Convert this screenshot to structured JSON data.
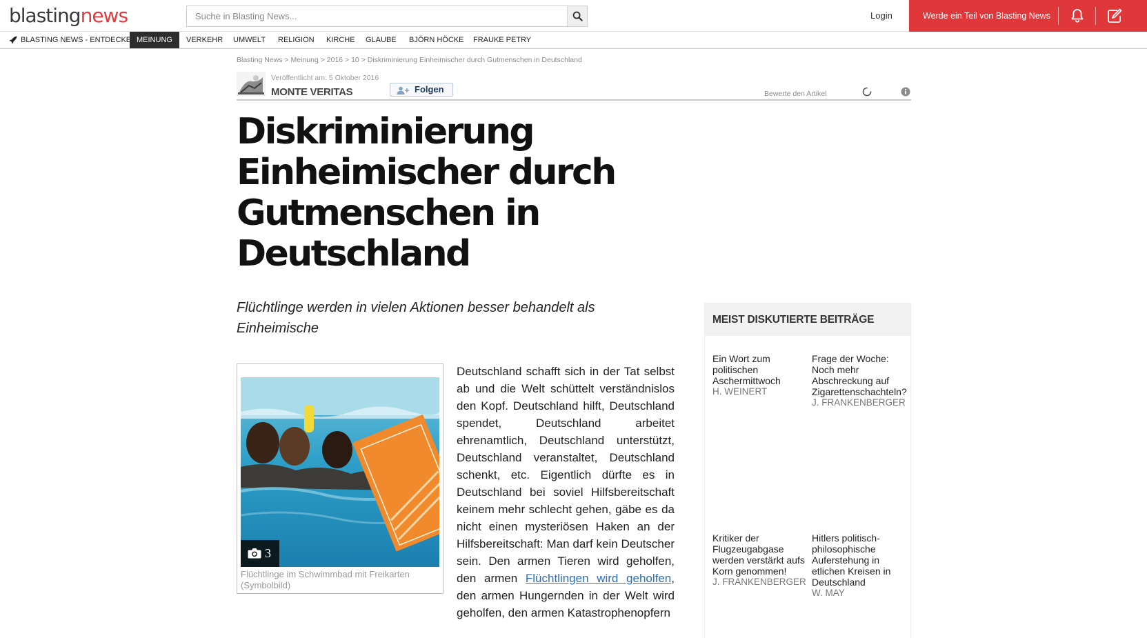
{
  "header": {
    "logo_part1": "blasting",
    "logo_part2": "news",
    "search_placeholder": "Suche in Blasting News...",
    "login_label": "Login",
    "cta_label": "Werde ein Teil von Blasting News",
    "colors": {
      "brand_red": "#e0373a",
      "nav_active": "#2d2d2d",
      "link_blue": "#2a6fb8"
    }
  },
  "nav": {
    "home_label": "BLASTING NEWS - ENTDECKE",
    "items": [
      "MEINUNG",
      "VERKEHR",
      "UMWELT",
      "RELIGION",
      "KIRCHE",
      "GLAUBE",
      "BJÖRN HÖCKE",
      "FRAUKE PETRY"
    ],
    "active": "MEINUNG"
  },
  "breadcrumb": [
    "Blasting News",
    "Meinung",
    "2016",
    "10",
    "Diskriminierung Einheimischer durch Gutmenschen in Deutschland"
  ],
  "article": {
    "published": "Veröffentlicht am: 5 Oktober 2016",
    "author": "MONTE VERITAS",
    "follow_label": "Folgen",
    "rate_label": "Bewerte den Artikel",
    "title": "Diskriminierung Einheimischer durch Gutmenschen in Deutschland",
    "subtitle": "Flüchtlinge werden in vielen Aktionen besser behandelt als Einheimische",
    "photo_count": "3",
    "photo_caption": "Flüchtlinge im Schwimmbad mit Freikarten (Symbolbild)",
    "body_before_link": "Deutschland schafft sich in der Tat selbst ab und die Welt schüttelt verständnislos den Kopf. Deutschland hilft, Deutschland spendet, Deutschland arbeitet ehrenamtlich, Deutschland unterstützt, Deutschland veranstaltet, Deutschland schenkt, etc. Eigentlich dürfte es in Deutschland bei soviel Hilfsbereitschaft keinem mehr schlecht gehen, gäbe es da nicht einen mysteriösen Haken an der Hilfsbereitschaft: Man darf kein Deutscher sein. Den armen Tieren wird geholfen, den armen ",
    "body_link": "Flüchtlingen wird geholfen",
    "body_after_link": ", den armen Hungernden in der Welt wird geholfen, den armen Katastrophenopfern"
  },
  "sidebar": {
    "heading": "MEIST DISKUTIERTE BEITRÄGE",
    "items": [
      {
        "title": "Ein Wort zum politischen Aschermittwoch",
        "author": "H. WEINERT"
      },
      {
        "title": "Frage der Woche: Noch mehr Abschreckung auf Zigarettenschachteln?",
        "author": "J. FRANKENBERGER"
      },
      {
        "title": "Kritiker der Flugzeugabgase werden verstärkt aufs Korn genommen!",
        "author": "J. FRANKENBERGER"
      },
      {
        "title": "Hitlers politisch-philosophische Auferstehung in etlichen Kreisen in Deutschland",
        "author": "W. MAY"
      }
    ]
  }
}
